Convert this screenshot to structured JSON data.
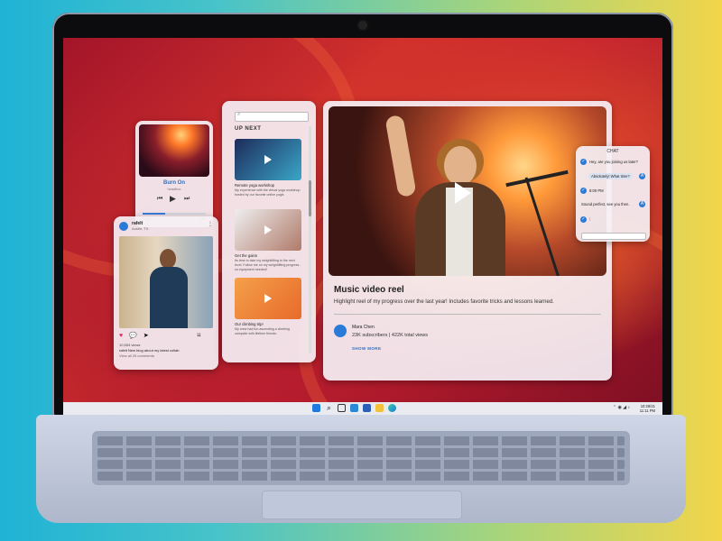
{
  "music_player": {
    "track_title": "Burn On",
    "artist": "headline",
    "time_elapsed": "1:12",
    "time_total": "3:41",
    "progress": 0.35,
    "controls": [
      "prev",
      "play",
      "next"
    ]
  },
  "social_post": {
    "username": "rafelt",
    "location": "Austin, TX",
    "views": "10,553 views",
    "caption": "rafelt New blog about my latest collab",
    "comments": "View all 25 comments"
  },
  "up_next": {
    "search_placeholder": "",
    "heading": "UP NEXT",
    "videos": [
      {
        "title": "Remote yoga workshop",
        "desc": "My experience with the virtual yoga workshop hosted by our favorite online yogis"
      },
      {
        "title": "Get the gains",
        "desc": "Its time to take my weightlifting to the next level. Follow me on my weightlifting progress - no equipment needed!"
      },
      {
        "title": "Our climbing trip!",
        "desc": "My crew had fun ascending a climbing campsite with lifetime friends."
      }
    ]
  },
  "featured": {
    "title": "Music video reel",
    "description": "Highlight reel of my progress over the last year! Includes favorite tricks and lessons learned.",
    "channel_name": "Mara Chen",
    "channel_stats": "23K subscribers | 422K total views",
    "show_more": "SHOW MORE"
  },
  "chat": {
    "header": "CHAT",
    "messages": [
      {
        "from": "other",
        "text": "Hey, are you joining us later?"
      },
      {
        "from": "me",
        "text": "Absolutely! What time?"
      },
      {
        "from": "other",
        "text": "8:00 PM"
      },
      {
        "from": "other",
        "text": "Sound perfect, see you then."
      }
    ]
  },
  "taskbar": {
    "time": "10:28/21",
    "date": "11:11 PM",
    "icons": [
      "windows-logo",
      "search",
      "task-view",
      "widgets",
      "store",
      "file-explorer",
      "edge"
    ]
  },
  "colors": {
    "accent": "#2a7bd8",
    "taskbar": "#e9ebf1"
  }
}
